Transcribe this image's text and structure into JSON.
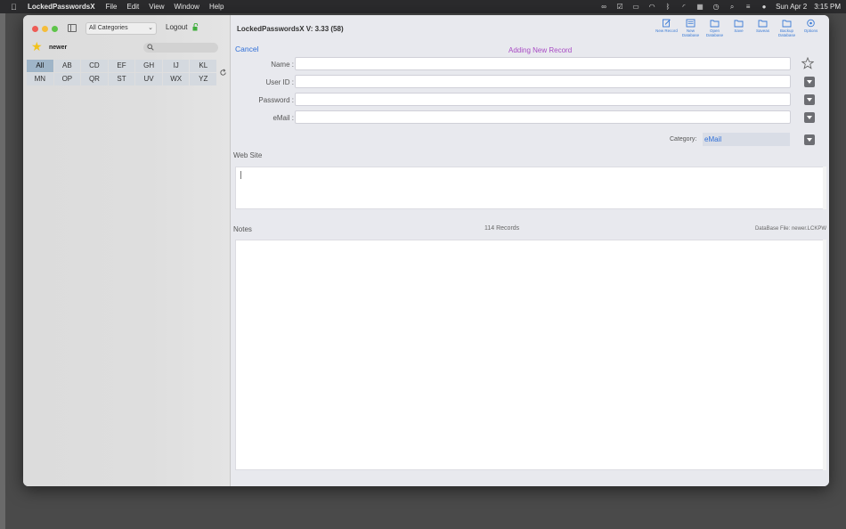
{
  "menubar": {
    "app_name": "LockedPasswordsX",
    "menus": [
      "File",
      "Edit",
      "View",
      "Window",
      "Help"
    ],
    "date": "Sun Apr 2",
    "time": "3:15 PM"
  },
  "sidebar": {
    "category_select": "All Categories",
    "logout_label": "Logout",
    "database_name": "newer",
    "alphabet_rows": [
      [
        "All",
        "AB",
        "CD",
        "EF",
        "GH",
        "IJ",
        "KL"
      ],
      [
        "MN",
        "OP",
        "QR",
        "ST",
        "UV",
        "WX",
        "YZ"
      ]
    ],
    "selected_filter": "All"
  },
  "main": {
    "title": "LockedPasswordsX V: 3.33 (58)",
    "toolbar": [
      {
        "label": "New Record",
        "icon": "new-record-icon"
      },
      {
        "label": "New Database",
        "icon": "new-database-icon"
      },
      {
        "label": "Open Database",
        "icon": "open-database-icon"
      },
      {
        "label": "Save",
        "icon": "save-icon"
      },
      {
        "label": "Saveas",
        "icon": "saveas-icon"
      },
      {
        "label": "Backup Database",
        "icon": "backup-database-icon"
      },
      {
        "label": "Options",
        "icon": "options-icon"
      }
    ],
    "cancel_label": "Cancel",
    "form_title": "Adding New Record",
    "fields": {
      "name_label": "Name :",
      "name_value": "",
      "userid_label": "User ID :",
      "userid_value": "",
      "password_label": "Password :",
      "password_value": "",
      "email_label": "eMail :",
      "email_value": ""
    },
    "category_label": "Category:",
    "category_value": "eMail",
    "website_label": "Web Site",
    "website_value": "",
    "notes_label": "Notes",
    "notes_value": "",
    "record_count": "114 Records",
    "database_file": "DataBase File: newer.LCKPW"
  },
  "colors": {
    "accent": "#2f6fd8",
    "form_title": "#a84ac4",
    "star": "#f2c21a"
  }
}
